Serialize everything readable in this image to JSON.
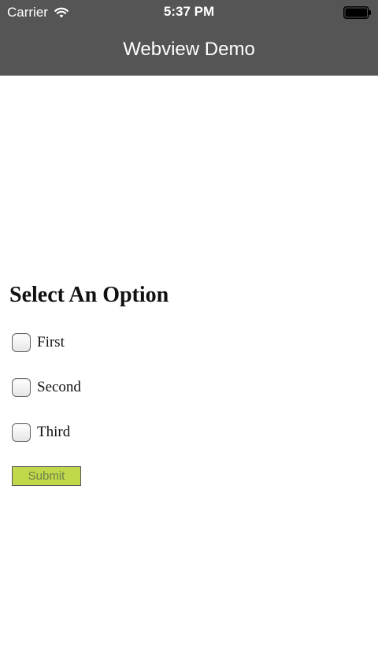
{
  "status_bar": {
    "carrier": "Carrier",
    "time": "5:37 PM",
    "wifi_icon": "wifi-icon",
    "battery_icon": "battery-full-icon"
  },
  "nav": {
    "title": "Webview Demo"
  },
  "form": {
    "heading": "Select An Option",
    "options": [
      {
        "label": "First",
        "checked": false
      },
      {
        "label": "Second",
        "checked": false
      },
      {
        "label": "Third",
        "checked": false
      }
    ],
    "submit_label": "Submit"
  },
  "colors": {
    "header_bg": "#555555",
    "submit_bg": "#bfd94a"
  }
}
